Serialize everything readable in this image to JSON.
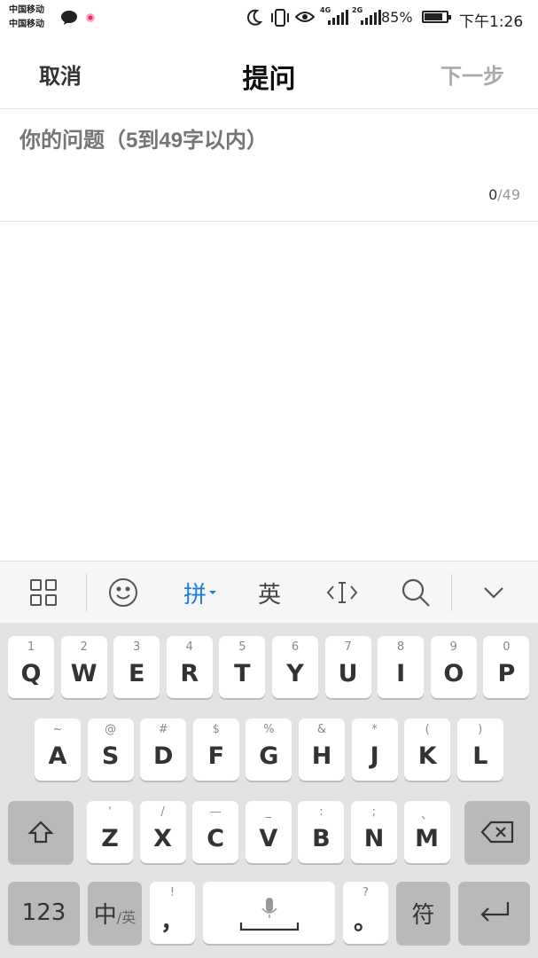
{
  "status_bar": {
    "carrier1": "中国移动",
    "carrier2": "中国移动",
    "net1": "4G",
    "net2": "2G",
    "battery": "85%",
    "battery_level": 0.85,
    "time": "下午1:26"
  },
  "header": {
    "cancel": "取消",
    "title": "提问",
    "next": "下一步"
  },
  "question": {
    "placeholder": "你的问题（5到49字以内）",
    "value": "",
    "count_current": "0",
    "count_max": "/49"
  },
  "keyboard_toolbar": {
    "pinyin": "拼",
    "english": "英",
    "icons": [
      "grid-icon",
      "emoji-icon",
      "cursor-icon",
      "search-icon",
      "collapse-icon"
    ]
  },
  "keyboard": {
    "row1": [
      {
        "hint": "1",
        "key": "Q"
      },
      {
        "hint": "2",
        "key": "W"
      },
      {
        "hint": "3",
        "key": "E"
      },
      {
        "hint": "4",
        "key": "R"
      },
      {
        "hint": "5",
        "key": "T"
      },
      {
        "hint": "6",
        "key": "Y"
      },
      {
        "hint": "7",
        "key": "U"
      },
      {
        "hint": "8",
        "key": "I"
      },
      {
        "hint": "9",
        "key": "O"
      },
      {
        "hint": "0",
        "key": "P"
      }
    ],
    "row2": [
      {
        "hint": "~",
        "key": "A"
      },
      {
        "hint": "@",
        "key": "S"
      },
      {
        "hint": "#",
        "key": "D"
      },
      {
        "hint": "$",
        "key": "F"
      },
      {
        "hint": "%",
        "key": "G"
      },
      {
        "hint": "&",
        "key": "H"
      },
      {
        "hint": "*",
        "key": "J"
      },
      {
        "hint": "(",
        "key": "K"
      },
      {
        "hint": ")",
        "key": "L"
      }
    ],
    "row3": [
      {
        "hint": "'",
        "key": "Z"
      },
      {
        "hint": "/",
        "key": "X"
      },
      {
        "hint": "—",
        "key": "C"
      },
      {
        "hint": "_",
        "key": "V"
      },
      {
        "hint": ":",
        "key": "B"
      },
      {
        "hint": ";",
        "key": "N"
      },
      {
        "hint": "、",
        "key": "M"
      }
    ],
    "num_key": "123",
    "lang_key_main": "中",
    "lang_key_sub": "/英",
    "comma_hint": "!",
    "comma_key": "，",
    "period_hint": "?",
    "period_key": "。",
    "symbol_key": "符"
  }
}
